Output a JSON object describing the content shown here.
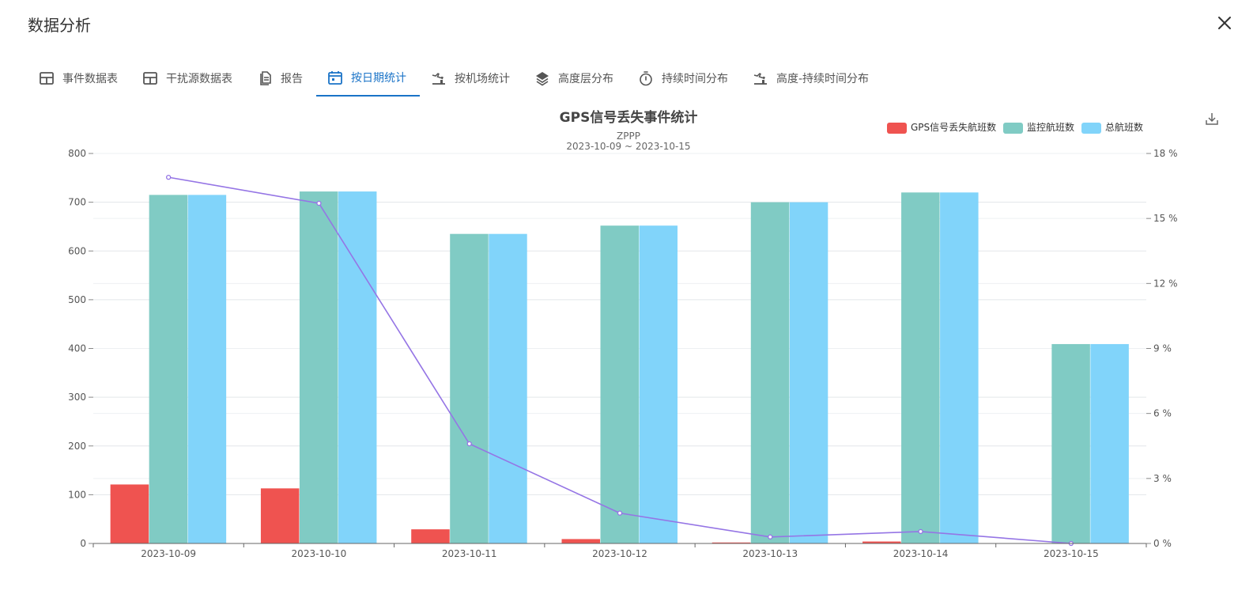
{
  "window": {
    "title": "数据分析"
  },
  "tabs": [
    {
      "label": "事件数据表",
      "icon": "table-icon",
      "active": false
    },
    {
      "label": "干扰源数据表",
      "icon": "table-icon",
      "active": false
    },
    {
      "label": "报告",
      "icon": "document-icon",
      "active": false
    },
    {
      "label": "按日期统计",
      "icon": "calendar-icon",
      "active": true
    },
    {
      "label": "按机场统计",
      "icon": "airport-icon",
      "active": false
    },
    {
      "label": "高度层分布",
      "icon": "layers-icon",
      "active": false
    },
    {
      "label": "持续时间分布",
      "icon": "timer-icon",
      "active": false
    },
    {
      "label": "高度-持续时间分布",
      "icon": "airport-icon",
      "active": false
    }
  ],
  "colors": {
    "accent": "#1a73c7",
    "lost": "#ef5350",
    "monitored": "#80cbc4",
    "total": "#81d4fa",
    "ratio": "#9575e5"
  },
  "chart_data": {
    "type": "bar",
    "title": "GPS信号丢失事件统计",
    "subtitle": "ZPPP",
    "subtitle2": "2023-10-09 ~ 2023-10-15",
    "categories": [
      "2023-10-09",
      "2023-10-10",
      "2023-10-11",
      "2023-10-12",
      "2023-10-13",
      "2023-10-14",
      "2023-10-15"
    ],
    "series": [
      {
        "name": "GPS信号丢失航班数",
        "color": "#ef5350",
        "values": [
          121,
          113,
          29,
          9,
          2,
          4,
          0
        ]
      },
      {
        "name": "监控航班数",
        "color": "#80cbc4",
        "values": [
          715,
          722,
          635,
          652,
          700,
          720,
          409
        ]
      },
      {
        "name": "总航班数",
        "color": "#81d4fa",
        "values": [
          715,
          722,
          635,
          652,
          700,
          720,
          409
        ]
      }
    ],
    "line": {
      "axis": "right",
      "color": "#9575e5",
      "values": [
        16.9,
        15.7,
        4.6,
        1.4,
        0.3,
        0.55,
        0
      ]
    },
    "yticks_left": [
      "0",
      "100",
      "200",
      "300",
      "400",
      "500",
      "600",
      "700",
      "800"
    ],
    "yticks_right": [
      "0 %",
      "3 %",
      "6 %",
      "9 %",
      "12 %",
      "15 %",
      "18 %"
    ],
    "ylim": [
      0,
      800
    ],
    "ylim_right": [
      0,
      18
    ],
    "grid": true,
    "legend": "top-right"
  }
}
